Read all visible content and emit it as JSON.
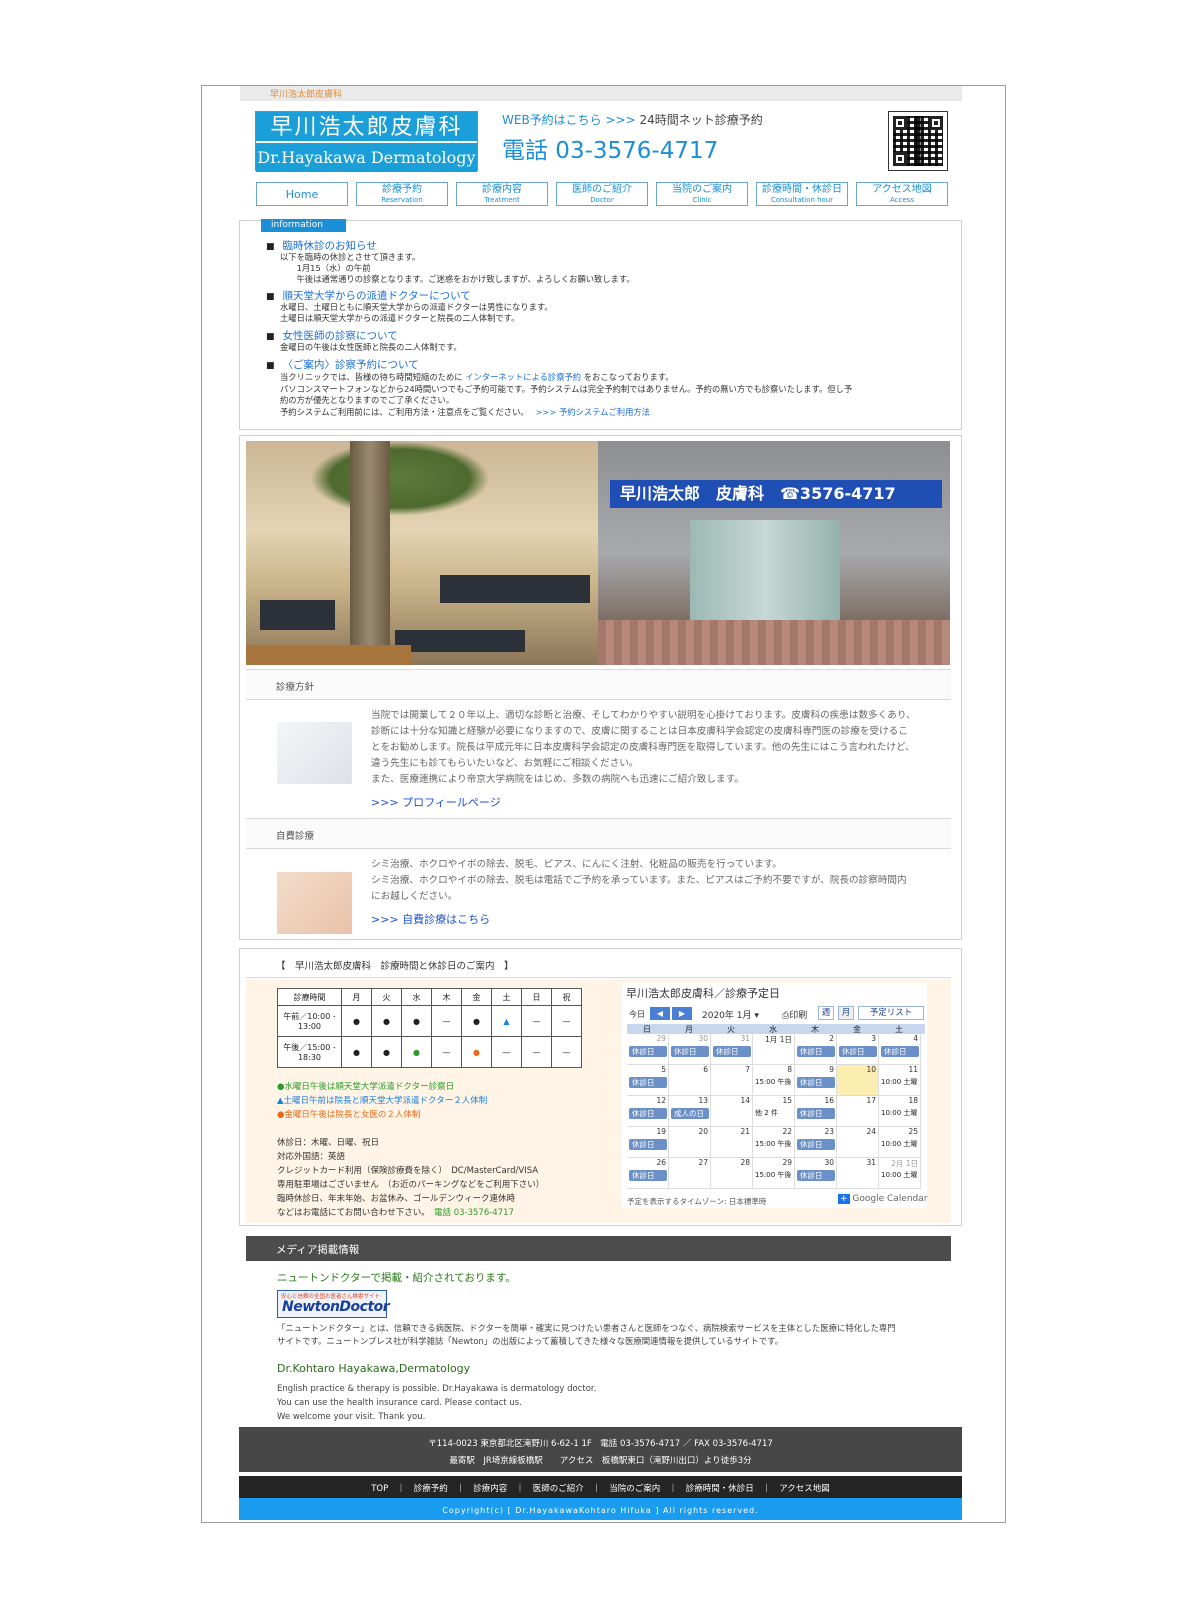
{
  "header": {
    "top_label": "早川浩太郎皮膚科",
    "logo_jp": "早川浩太郎皮膚科",
    "logo_en": "Dr.Hayakawa Dermatology",
    "web_res_link": "WEB予約はこちら >>>",
    "web_res_desc": "24時間ネット診療予約",
    "tel": "電話 03-3576-4717"
  },
  "nav": [
    {
      "label": "Home",
      "sub": ""
    },
    {
      "label": "診療予約",
      "sub": "Reservation"
    },
    {
      "label": "診療内容",
      "sub": "Treatment"
    },
    {
      "label": "医師のご紹介",
      "sub": "Doctor"
    },
    {
      "label": "当院のご案内",
      "sub": "Clinic"
    },
    {
      "label": "診療時間・休診日",
      "sub": "Consultation hour"
    },
    {
      "label": "アクセス地図",
      "sub": "Access"
    }
  ],
  "info": {
    "tag": "information",
    "items": [
      {
        "title": "臨時休診のお知らせ",
        "lines": [
          "以下を臨時の休診とさせて頂きます。",
          "　　1月15（水）の午前",
          "　　午後は通常通りの診察となります。ご迷惑をおかけ致しますが、よろしくお願い致します。"
        ]
      },
      {
        "title": "順天堂大学からの派遣ドクターについて",
        "lines": [
          "水曜日、土曜日ともに順天堂大学からの派遣ドクターは男性になります。",
          "土曜日は順天堂大学からの派遣ドクターと院長の二人体制です。"
        ]
      },
      {
        "title": "女性医師の診察について",
        "lines": [
          "金曜日の午後は女性医師と院長の二人体制です。"
        ]
      },
      {
        "title": "〈ご案内〉診察予約について",
        "lines": [
          "パソコンスマートフォンなどから24時間いつでもご予約可能です。予約システムは完全予約制ではありません。予約の無い方でも診察いたします。但し予",
          "約の方が優先となりますのでご了承ください。"
        ]
      }
    ],
    "reserve_pre": "当クリニックでは、皆様の待ち時間短縮のために",
    "reserve_link": "インターネットによる診察予約",
    "reserve_post": "をおこなっております。",
    "reserve_note": "予約システムご利用前には、ご利用方法・注意点をご覧ください。",
    "reserve_howto": ">>> 予約システムご利用方法"
  },
  "photos": {
    "sign": "早川浩太郎　皮膚科　☎3576-4717"
  },
  "policy": {
    "heading": "診療方針",
    "text": "当院では開業して２０年以上、適切な診断と治療、そしてわかりやすい説明を心掛けております。皮膚科の疾患は数多くあり、診断には十分な知識と経験が必要になりますので、皮膚に関することは日本皮膚科学会認定の皮膚科専門医の診療を受けることをお勧めします。院長は平成元年に日本皮膚科学会認定の皮膚科専門医を取得しています。他の先生にはこう言われたけど、違う先生にも診てもらいたいなど、お気軽にご相談ください。",
    "text2": "また、医療連携により帝京大学病院をはじめ、多数の病院へも迅速にご紹介致します。",
    "link": ">>> プロフィールページ"
  },
  "selfpay": {
    "heading": "自費診療",
    "line1": "シミ治療、ホクロやイボの除去、脱毛、ピアス、にんにく注射、化粧品の販売を行っています。",
    "line2": "シミ治療、ホクロやイボの除去、脱毛は電話でご予約を承っています。また、ピアスはご予約不要ですが、院長の診察時間内にお越しください。",
    "link": ">>> 自費診療はこちら"
  },
  "hours": {
    "heading": "【　早川浩太郎皮膚科　診療時間と休診日のご案内　】",
    "table_head": [
      "診療時間",
      "月",
      "火",
      "水",
      "木",
      "金",
      "土",
      "日",
      "祝"
    ],
    "row1_label1": "午前／10:00 -",
    "row1_label2": "13:00",
    "row2_label1": "午後／15:00 -",
    "row2_label2": "18:30",
    "row1": [
      "●",
      "●",
      "●",
      "—",
      "●",
      "▲",
      "—",
      "—"
    ],
    "row2": [
      "●",
      "●",
      "●",
      "—",
      "●",
      "—",
      "—",
      "—"
    ],
    "note_green": "●水曜日午後は順天堂大学派遣ドクター診察日",
    "note_blue": "▲土曜日午前は院長と順天堂大学派遣ドクター２人体制",
    "note_orange": "●金曜日午後は院長と女医の２人体制",
    "details": [
      "休診日：木曜、日曜、祝日",
      "対応外国語：英語",
      "クレジットカード利用（保険診療費を除く）　DC/MasterCard/VISA",
      "専用駐車場はございません　（お近のパーキングなどをご利用下さい）",
      "臨時休診日、年末年始、お盆休み、ゴールデンウィーク連休時"
    ],
    "last_line": "などはお電話にてお問い合わせ下さい。",
    "tel": "電話 03-3576-4717",
    "colors": {
      "green": "#2a9a2a",
      "blue": "#1a7fe0",
      "orange": "#e66a1a"
    }
  },
  "calendar": {
    "title": "早川浩太郎皮膚科／診療予定日",
    "today": "今日",
    "month": "2020年 1月 ▾",
    "print": "印刷",
    "week": "週",
    "monthview": "月",
    "list": "予定リスト",
    "weekdays": [
      "日",
      "月",
      "火",
      "水",
      "木",
      "金",
      "土"
    ],
    "weeks": [
      [
        "29",
        "30",
        "31",
        "1月 1日",
        "2",
        "3",
        "4"
      ],
      [
        "5",
        "6",
        "7",
        "8",
        "9",
        "10",
        "11"
      ],
      [
        "12",
        "13",
        "14",
        "15",
        "16",
        "17",
        "18"
      ],
      [
        "19",
        "20",
        "21",
        "22",
        "23",
        "24",
        "25"
      ],
      [
        "26",
        "27",
        "28",
        "29",
        "30",
        "31",
        "2月 1日"
      ]
    ],
    "ev_closed": "休診日",
    "ev_coming": "成人の日",
    "ev_pm": "15:00 午後",
    "ev_sat": "10:00 土曜",
    "ev_more": "他 2 件",
    "footer": "予定を表示するタイムゾーン: 日本標準時",
    "gcal": "Google Calendar"
  },
  "media": {
    "heading": "メディア掲載情報",
    "newton_title": "ニュートンドクターで掲載・紹介されております。",
    "newton_logo_small": "安心と信頼の全国お医者さん検索サイト",
    "newton_logo": "NewtonDoctor",
    "newton_desc1": "「ニュートンドクター」とは、信頼できる病医院、ドクターを簡単・確実に見つけたい患者さんと医師をつなぐ、病院検索サービスを主体とした医療に特化した専門",
    "newton_desc2": "サイトです。ニュートンプレス社が科学雑誌「Newton」の出版によって蓄積してきた様々な医療関連情報を提供しているサイトです。",
    "en_title": "Dr.Kohtaro Hayakawa,Dermatology",
    "en_lines": [
      "English practice & therapy is possible. Dr.Hayakawa is dermatology doctor.",
      "You can use the health insurance card. Please contact us.",
      "We welcome your visit. Thank you."
    ]
  },
  "footer": {
    "address": "〒114-0023 東京都北区滝野川 6-62-1 1F　電話 03-3576-4717 ／ FAX 03-3576-4717",
    "access": "最寄駅　JR埼京線板橋駅　　アクセス　板橋駅東口（滝野川出口）より徒歩3分",
    "links": "TOP　｜　診療予約　｜　診療内容　｜　医師のご紹介　｜　当院のご案内　｜　診療時間・休診日　｜　アクセス地図",
    "copyright": "Copyright(c) [ Dr.HayakawaKohtaro Hifuka ] All rights reserved."
  }
}
